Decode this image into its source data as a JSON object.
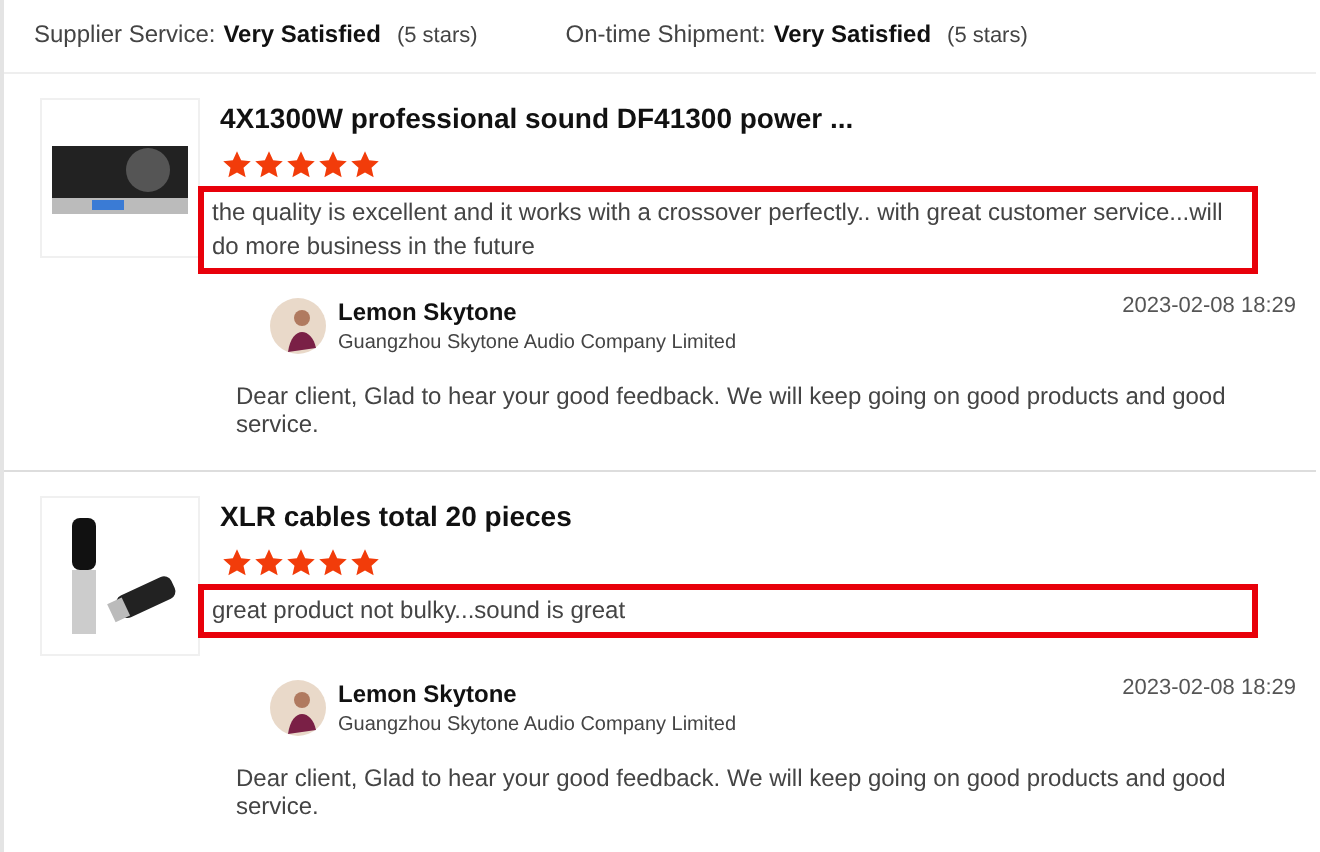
{
  "ratings": [
    {
      "label": "Supplier Service:",
      "value": "Very Satisfied",
      "note": "(5 stars)"
    },
    {
      "label": "On-time Shipment:",
      "value": "Very Satisfied",
      "note": "(5 stars)"
    }
  ],
  "reviews": [
    {
      "kind": "amplifier",
      "title": "4X1300W professional sound DF41300 power ...",
      "stars": 5,
      "comment": "the quality is excellent and it works with a crossover perfectly.. with great customer service...will do more business in the future",
      "highlighted": true,
      "reply": {
        "name": "Lemon Skytone",
        "company": "Guangzhou Skytone Audio Company Limited",
        "time": "2023-02-08 18:29",
        "text": "Dear client, Glad to hear your good feedback. We will keep going on good products and good service."
      }
    },
    {
      "kind": "cable",
      "title": "XLR cables total 20 pieces",
      "stars": 5,
      "comment": "great product not bulky...sound is great",
      "highlighted": true,
      "reply": {
        "name": "Lemon Skytone",
        "company": "Guangzhou Skytone Audio Company Limited",
        "time": "2023-02-08 18:29",
        "text": "Dear client, Glad to hear your good feedback. We will keep going on good products and good service."
      }
    }
  ]
}
